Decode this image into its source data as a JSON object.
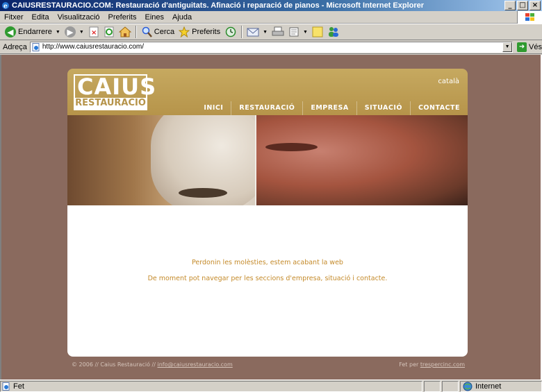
{
  "window": {
    "title": "CAIUSRESTAURACIO.COM: Restauració d'antiguitats. Afinació i reparació de pianos - Microsoft Internet Explorer",
    "minimize": "_",
    "maximize": "□",
    "close": "×"
  },
  "menubar": {
    "items": [
      "Fitxer",
      "Edita",
      "Visualització",
      "Preferits",
      "Eines",
      "Ajuda"
    ]
  },
  "toolbar": {
    "back_label": "Endarrere",
    "search_label": "Cerca",
    "favorites_label": "Preferits"
  },
  "address": {
    "label": "Adreça",
    "url": "http://www.caiusrestauracio.com/",
    "go_label": "Vés"
  },
  "site": {
    "logo_line1": "CAIUS",
    "logo_line2": "RESTAURACIÓ",
    "language": "català",
    "nav": [
      "INICI",
      "RESTAURACIÓ",
      "EMPRESA",
      "SITUACIÓ",
      "CONTACTE"
    ],
    "message1": "Perdonin les molèsties, estem acabant la web",
    "message2": "De moment pot navegar per les seccions d'empresa, situació i contacte.",
    "footer_left": "© 2006 // Caius Restauració //",
    "footer_email": "info@caiusrestauracio.com",
    "footer_right": "Fet per",
    "footer_credit": "trespercinc.com"
  },
  "status": {
    "text": "Fet",
    "zone": "Internet"
  },
  "colors": {
    "header_gold": "#b6944a",
    "page_bg": "#8a6a5e",
    "message_text": "#c48a2a"
  }
}
